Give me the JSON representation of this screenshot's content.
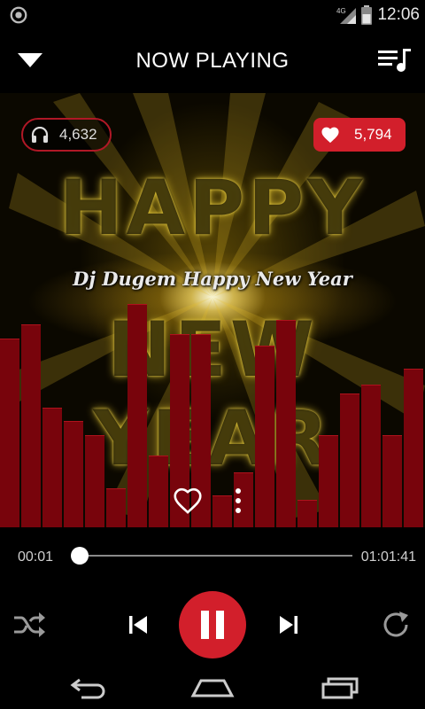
{
  "status_bar": {
    "time": "12:06",
    "network": "4G",
    "icons": [
      "sync-icon",
      "signal-icon",
      "battery-icon"
    ]
  },
  "header": {
    "title": "NOW PLAYING",
    "left_icon": "chevron-down-icon",
    "right_icon": "queue-music-icon"
  },
  "track": {
    "title": "Dj Dugem Happy New Year",
    "listen_count": "4,632",
    "like_count": "5,794",
    "elapsed": "00:01",
    "duration": "01:01:41",
    "progress": 0.0
  },
  "artwork": {
    "line1": "HAPPY",
    "line2": "NEW YEAR"
  },
  "equalizer": {
    "levels": [
      0.82,
      0.88,
      0.52,
      0.46,
      0.4,
      0.17,
      0.97,
      0.31,
      0.84,
      0.84,
      0.14,
      0.24,
      0.79,
      0.9,
      0.12,
      0.4,
      0.58,
      0.62,
      0.4,
      0.69
    ]
  },
  "controls": {
    "icons": [
      "shuffle-icon",
      "skip-previous-icon",
      "pause-icon",
      "skip-next-icon",
      "repeat-icon"
    ],
    "state": "playing"
  },
  "nav": {
    "icons": [
      "back-icon",
      "home-icon",
      "recent-apps-icon"
    ]
  },
  "colors": {
    "accent": "#d21f2b",
    "equalizer": "#78040c",
    "background": "#000000"
  }
}
